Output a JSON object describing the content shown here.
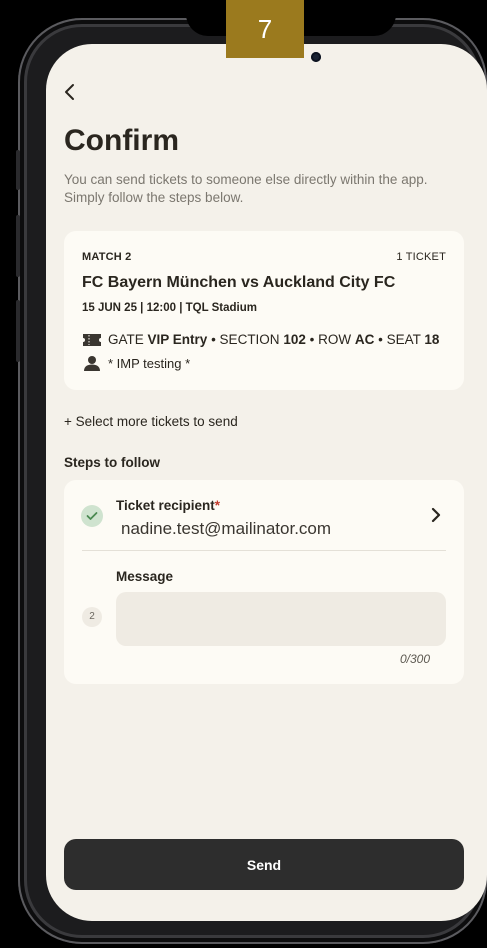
{
  "step_badge": "7",
  "header": {
    "title": "Confirm",
    "subtitle": "You can send tickets to someone else directly within the app. Simply follow the steps below."
  },
  "ticket": {
    "match_label": "MATCH 2",
    "ticket_count": "1 TICKET",
    "match_title": "FC Bayern München vs Auckland City FC",
    "match_info": "15 JUN 25 | 12:00 | TQL Stadium",
    "gate_prefix": "GATE",
    "gate": "VIP Entry",
    "section_prefix": "• SECTION",
    "section": "102",
    "row_prefix": "• ROW",
    "row": "AC",
    "seat_prefix": "• SEAT",
    "seat": "18",
    "holder": "* IMP testing  *"
  },
  "select_more_label": "+ Select more tickets to send",
  "steps_heading": "Steps to follow",
  "steps": {
    "recipient_label": "Ticket recipient",
    "recipient_required": "*",
    "recipient_value": "nadine.test@mailinator.com",
    "message_step_number": "2",
    "message_label": "Message",
    "message_value": "",
    "char_count": "0/300"
  },
  "send_label": "Send",
  "colors": {
    "badge": "#9b7a1e",
    "screen_bg": "#f4f1ea",
    "card_bg": "#fdfbf5",
    "send_button": "#2d2d2d",
    "check_circle": "#cfe3cf",
    "required": "#c23a2b"
  },
  "icons": [
    "back-arrow-icon",
    "ticket-icon",
    "person-icon",
    "check-icon",
    "chevron-right-icon"
  ]
}
